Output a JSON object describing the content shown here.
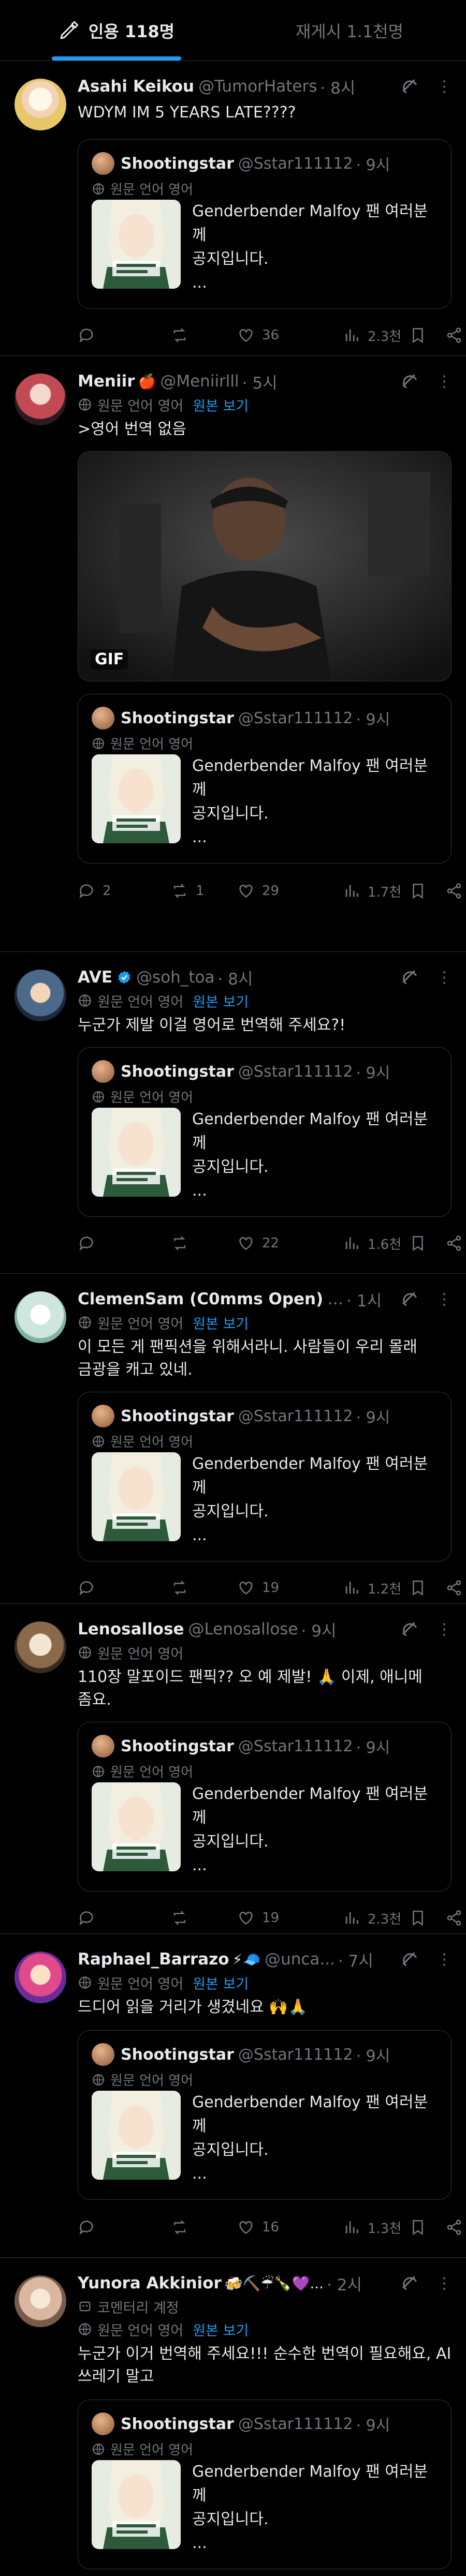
{
  "tabs": [
    {
      "label": "인용 118명",
      "active": true
    },
    {
      "label": "재게시 1.1천명",
      "active": false
    }
  ],
  "quoted": {
    "name": "Shootingstar",
    "handle": "@Sstar111112",
    "time": "· 9시",
    "translate_label": "원문 언어 영어",
    "text_line1": "Genderbender Malfoy 팬 여러분께",
    "text_line2": "공지입니다.",
    "text_line3": "..."
  },
  "tweets": [
    {
      "name": "Asahi Keikou",
      "handle": "@TumorHaters",
      "time": "· 8시",
      "text": "WDYM IM 5 YEARS LATE????",
      "reply": "",
      "retweet": "",
      "like": "36",
      "views": "2.3천"
    },
    {
      "name": "Meniir",
      "emoji": "🍎",
      "handle": "@Meniirlll",
      "time": "· 5시",
      "translate": "원문 언어 영어",
      "translate_link": "원본 보기",
      "text": ">영어 번역 없음",
      "gif_label": "GIF",
      "reply": "2",
      "retweet": "1",
      "like": "29",
      "views": "1.7천"
    },
    {
      "name": "AVE",
      "handle": "@soh_toa",
      "time": "· 8시",
      "translate": "원문 언어 영어",
      "translate_link": "원본 보기",
      "text": "누군가 제발 이걸 영어로 번역해 주세요?!",
      "reply": "",
      "retweet": "",
      "like": "22",
      "views": "1.6천"
    },
    {
      "name": "ClemenSam (C0mms Open)",
      "handle": "…",
      "time": "· 1시",
      "translate": "원문 언어 영어",
      "translate_link": "원본 보기",
      "text": "이 모든 게 팬픽션을 위해서라니. 사람들이 우리 몰래 금광을 캐고 있네.",
      "reply": "",
      "retweet": "",
      "like": "19",
      "views": "1.2천"
    },
    {
      "name": "Lenosallose",
      "handle": "@Lenosallose",
      "time": "· 9시",
      "translate": "원문 언어 영어",
      "text": "110장 말포이드 팬픽?? 오 예 제발! 🙏 이제, 애니메 좀요.",
      "reply": "",
      "retweet": "",
      "like": "19",
      "views": "2.3천"
    },
    {
      "name": "Raphael_Barrazo",
      "emoji": "⚡🧢",
      "handle": "@unca...",
      "time": "· 7시",
      "translate": "원문 언어 영어",
      "translate_link": "원본 보기",
      "text": "드디어 읽을 거리가 생겼네요 🙌🙏",
      "reply": "",
      "retweet": "",
      "like": "16",
      "views": "1.3천"
    },
    {
      "name": "Yunora Akkinior",
      "emoji": "🍻⛏️☔🍾💜...",
      "handle": "",
      "time": "· 2시",
      "commentary": "코멘터리 계정",
      "translate": "원문 언어 영어",
      "translate_link": "원본 보기",
      "text": "누군가 이거 번역해 주세요!!! 순수한 번역이 필요해요, AI 쓰레기 말고"
    }
  ],
  "colors": {
    "accent": "#1d9bf0",
    "muted": "#71767b",
    "text": "#e7e9ea",
    "border": "#2f3336",
    "background": "#000000"
  }
}
